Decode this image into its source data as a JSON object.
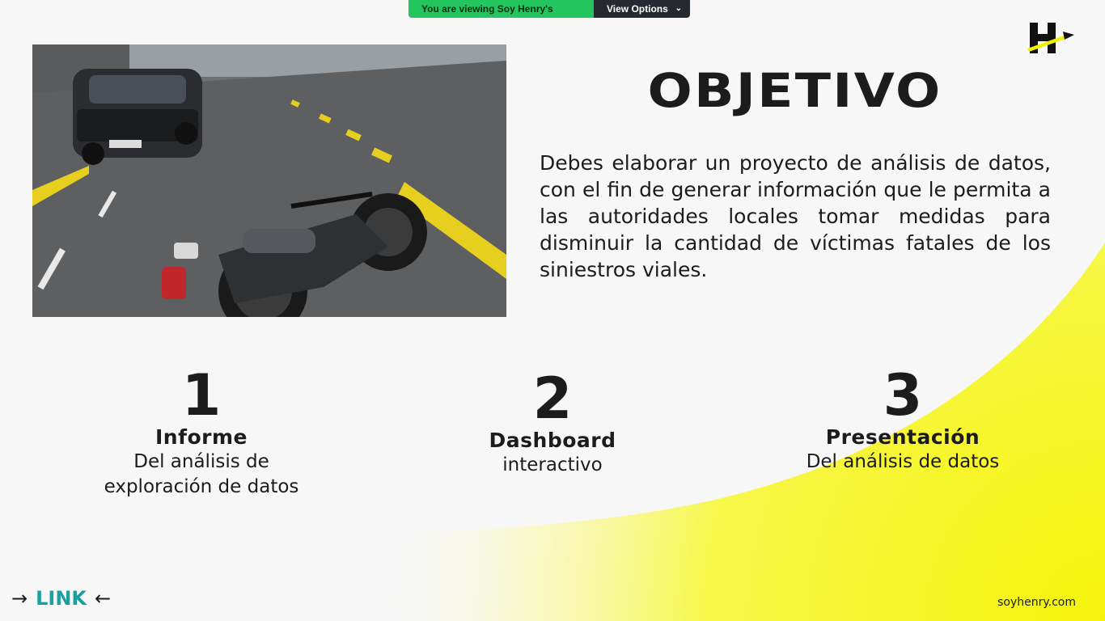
{
  "screen_share": {
    "status": "You are viewing Soy Henry's screen",
    "view_options": "View Options",
    "view_options_icon": "chevron-down-icon"
  },
  "slide": {
    "logo_icon": "henry-logo",
    "photo_alt": "motorcycle-accident-photo",
    "title": "OBJETIVO",
    "description": "Debes elaborar un proyecto de análisis de datos, con el fin de generar información que le permita a las autoridades locales tomar medidas para disminuir la cantidad de víctimas fatales de los siniestros viales.",
    "steps": [
      {
        "number": "1",
        "title": "Informe",
        "line1": "Del análisis de",
        "line2": "exploración de datos"
      },
      {
        "number": "2",
        "title": "Dashboard",
        "line1": "interactivo",
        "line2": ""
      },
      {
        "number": "3",
        "title": "Presentación",
        "line1": "Del análisis de datos",
        "line2": ""
      }
    ],
    "link": {
      "arrow_left": "→",
      "label": "LINK",
      "arrow_right": "←"
    },
    "website": "soyhenry.com"
  },
  "colors": {
    "accent_yellow": "#f5f51e",
    "teal_link": "#1aa0a0",
    "share_green": "#22c55e"
  }
}
